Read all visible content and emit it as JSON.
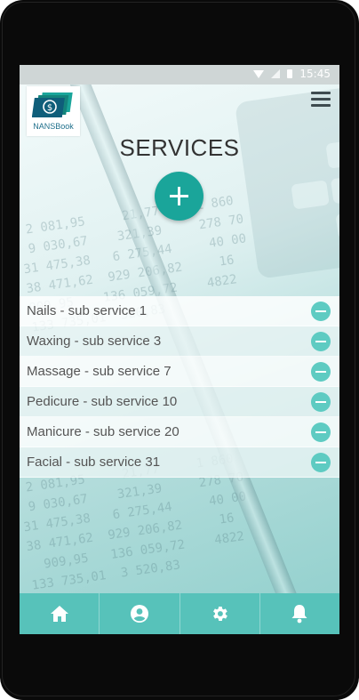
{
  "statusbar": {
    "time": "15:45",
    "icons": [
      "wifi-icon",
      "signal-icon",
      "battery-icon"
    ]
  },
  "header": {
    "logo_text": "NANSBook",
    "logo_icon": "dollar-bill-icon",
    "menu_icon": "hamburger-menu-icon",
    "title": "SERVICES",
    "add_icon": "plus-icon"
  },
  "services": [
    {
      "label": "Nails - sub service 1"
    },
    {
      "label": "Waxing - sub service 3"
    },
    {
      "label": "Massage - sub service 7"
    },
    {
      "label": "Pedicure - sub service 10"
    },
    {
      "label": "Manicure - sub service 20"
    },
    {
      "label": "Facial - sub service 31"
    }
  ],
  "bottom_nav": [
    {
      "icon": "home-icon"
    },
    {
      "icon": "account-icon"
    },
    {
      "icon": "settings-icon"
    },
    {
      "icon": "notifications-icon"
    }
  ],
  "colors": {
    "accent": "#1aa59a",
    "remove_button": "#5ecbc2",
    "bottom_nav": "#57c2ba",
    "title": "#333333"
  }
}
